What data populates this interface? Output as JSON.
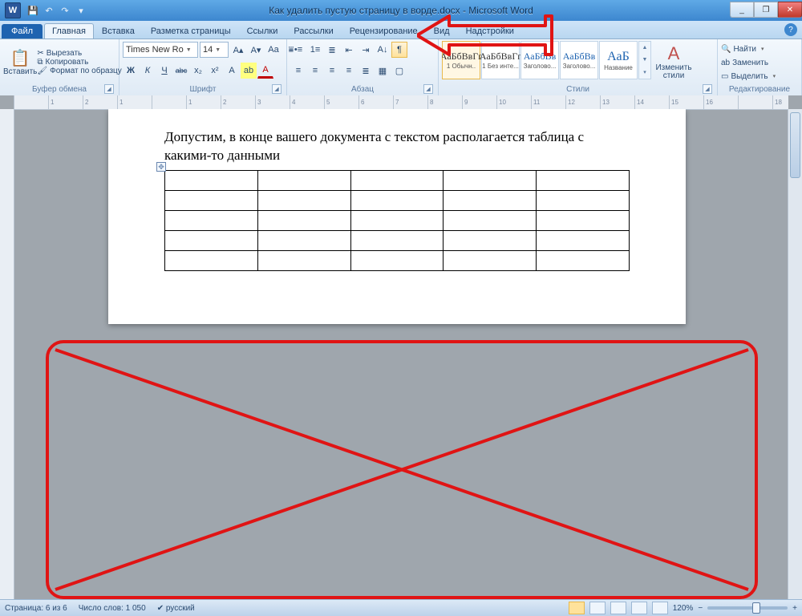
{
  "window": {
    "app_icon_letter": "W",
    "title": "Как удалить пустую страницу в ворде.docx - Microsoft Word",
    "qat": [
      "save",
      "undo",
      "redo",
      "repeat"
    ],
    "min": "_",
    "max": "❐",
    "close": "✕",
    "help": "?"
  },
  "tabs": {
    "file": "Файл",
    "items": [
      "Главная",
      "Вставка",
      "Разметка страницы",
      "Ссылки",
      "Рассылки",
      "Рецензирование",
      "Вид",
      "Надстройки"
    ],
    "active": 0
  },
  "ribbon": {
    "clipboard": {
      "paste": "Вставить",
      "cut": "Вырезать",
      "copy": "Копировать",
      "fmt": "Формат по образцу",
      "label": "Буфер обмена"
    },
    "font": {
      "name": "Times New Ro",
      "size": "14",
      "label": "Шрифт",
      "grow": "A▴",
      "shrink": "A▾",
      "case": "Aa",
      "clear": "⩸",
      "bold": "Ж",
      "italic": "К",
      "under": "Ч",
      "strike": "abc",
      "sub": "x₂",
      "sup": "x²",
      "effects": "A",
      "hilite": "ab",
      "color": "A"
    },
    "paragraph": {
      "label": "Абзац",
      "bullets": "•≡",
      "numbers": "1≡",
      "multi": "≣",
      "dedent": "⇤",
      "indent": "⇥",
      "sort": "A↓",
      "pilcrow": "¶",
      "al": "≡",
      "ac": "≡",
      "ar": "≡",
      "aj": "≡",
      "lsp": "≣",
      "shade": "▦",
      "border": "▢"
    },
    "styles": {
      "label": "Стили",
      "change": "Изменить стили",
      "items": [
        {
          "prev": "АаБбВвГг",
          "name": "1 Обычн..",
          "cls": "black",
          "sel": true
        },
        {
          "prev": "АаБбВвГг",
          "name": "1 Без инте...",
          "cls": "black"
        },
        {
          "prev": "АаБбВв",
          "name": "Заголово...",
          "cls": ""
        },
        {
          "prev": "АаБбВв",
          "name": "Заголово...",
          "cls": ""
        },
        {
          "prev": "АаБ",
          "name": "Название",
          "cls": ""
        }
      ]
    },
    "editing": {
      "label": "Редактирование",
      "find": "Найти",
      "replace": "Заменить",
      "select": "Выделить"
    }
  },
  "ruler": {
    "marks": [
      "",
      "1",
      "2",
      "1",
      "",
      "1",
      "2",
      "3",
      "4",
      "5",
      "6",
      "7",
      "8",
      "9",
      "10",
      "11",
      "12",
      "13",
      "14",
      "15",
      "16",
      "",
      "18"
    ]
  },
  "document": {
    "text": "Допустим, в конце вашего документа с текстом располагается таблица с какими-то данными",
    "table": {
      "rows": 5,
      "cols": 5
    }
  },
  "status": {
    "page": "Страница: 6 из 6",
    "words": "Число слов: 1 050",
    "lang": "русский",
    "zoom": "120%",
    "minus": "−",
    "plus": "+"
  }
}
